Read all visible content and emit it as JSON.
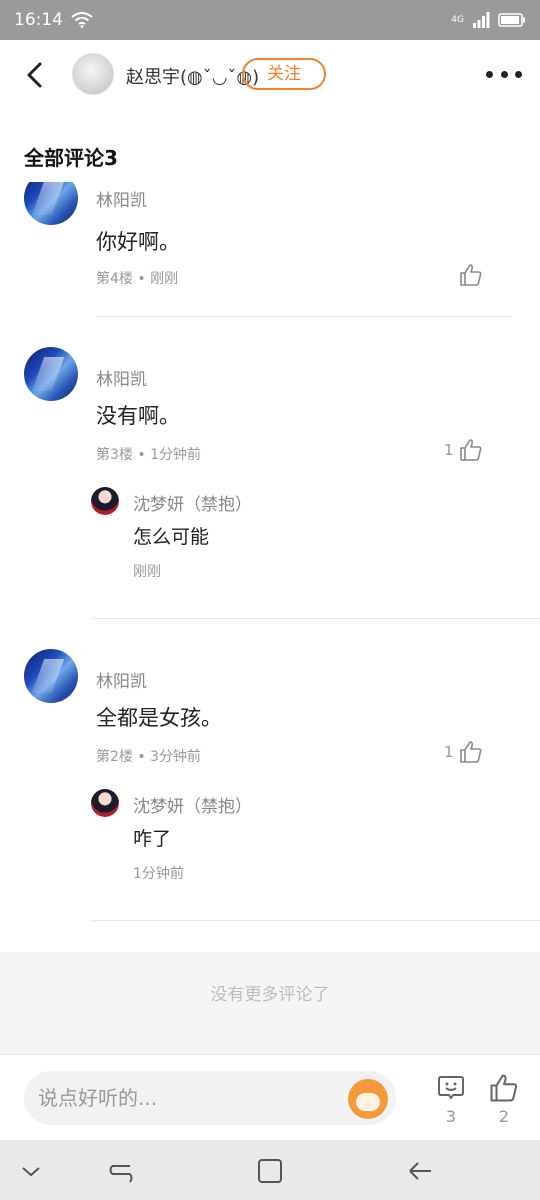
{
  "status_bar": {
    "time": "16:14",
    "network": "4G"
  },
  "header": {
    "username": "赵思宇(◍ˇ◡ˇ◍)",
    "follow_label": "关注"
  },
  "section_title": "全部评论3",
  "comments": [
    {
      "name": "林阳凯",
      "text": "你好啊。",
      "floor": "第4楼 • 刚刚",
      "likes": ""
    },
    {
      "name": "林阳凯",
      "text": "没有啊。",
      "floor": "第3楼 • 1分钟前",
      "likes": "1",
      "reply": {
        "name": "沈梦妍（禁抱）",
        "text": "怎么可能",
        "time": "刚刚"
      }
    },
    {
      "name": "林阳凯",
      "text": "全都是女孩。",
      "floor": "第2楼 • 3分钟前",
      "likes": "1",
      "reply": {
        "name": "沈梦妍（禁抱）",
        "text": "咋了",
        "time": "1分钟前"
      }
    }
  ],
  "no_more": "没有更多评论了",
  "bottom_bar": {
    "placeholder": "说点好听的...",
    "comment_count": "3",
    "like_count": "2"
  }
}
